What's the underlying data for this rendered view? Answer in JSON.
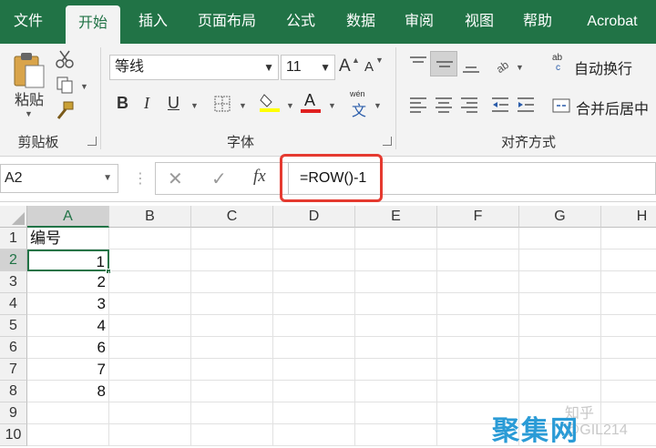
{
  "tabs": [
    "文件",
    "开始",
    "插入",
    "页面布局",
    "公式",
    "数据",
    "审阅",
    "视图",
    "帮助",
    "Acrobat"
  ],
  "active_tab": "开始",
  "clipboard": {
    "paste_label": "粘贴",
    "group_label": "剪贴板"
  },
  "font": {
    "name": "等线",
    "size": "11",
    "group_label": "字体",
    "grow": "A",
    "shrink": "A",
    "bold": "B",
    "italic": "I",
    "underline": "U",
    "font_color_glyph": "A",
    "phonetic_top": "wén",
    "phonetic_bottom": "文"
  },
  "alignment": {
    "wrap_label": "自动换行",
    "merge_label": "合并后居中",
    "group_label": "对齐方式",
    "wrap_icon_top": "ab",
    "wrap_icon_bottom": "c"
  },
  "colors": {
    "accent": "#217346",
    "highlight_box": "#e53a30",
    "fill_yellow": "#ffff00",
    "font_red": "#e02020"
  },
  "formula_bar": {
    "name_box": "A2",
    "fx_label": "fx",
    "formula": "=ROW()-1"
  },
  "sheet": {
    "columns": [
      "A",
      "B",
      "C",
      "D",
      "E",
      "F",
      "G",
      "H"
    ],
    "rows": [
      "1",
      "2",
      "3",
      "4",
      "5",
      "6",
      "7",
      "8",
      "9",
      "10"
    ],
    "cells": [
      [
        "编号"
      ],
      [
        "1"
      ],
      [
        "2"
      ],
      [
        "3"
      ],
      [
        "4"
      ],
      [
        "6"
      ],
      [
        "7"
      ],
      [
        "8"
      ]
    ]
  },
  "watermark": {
    "text1": "知乎 @GIL214",
    "text2": "聚集网"
  }
}
